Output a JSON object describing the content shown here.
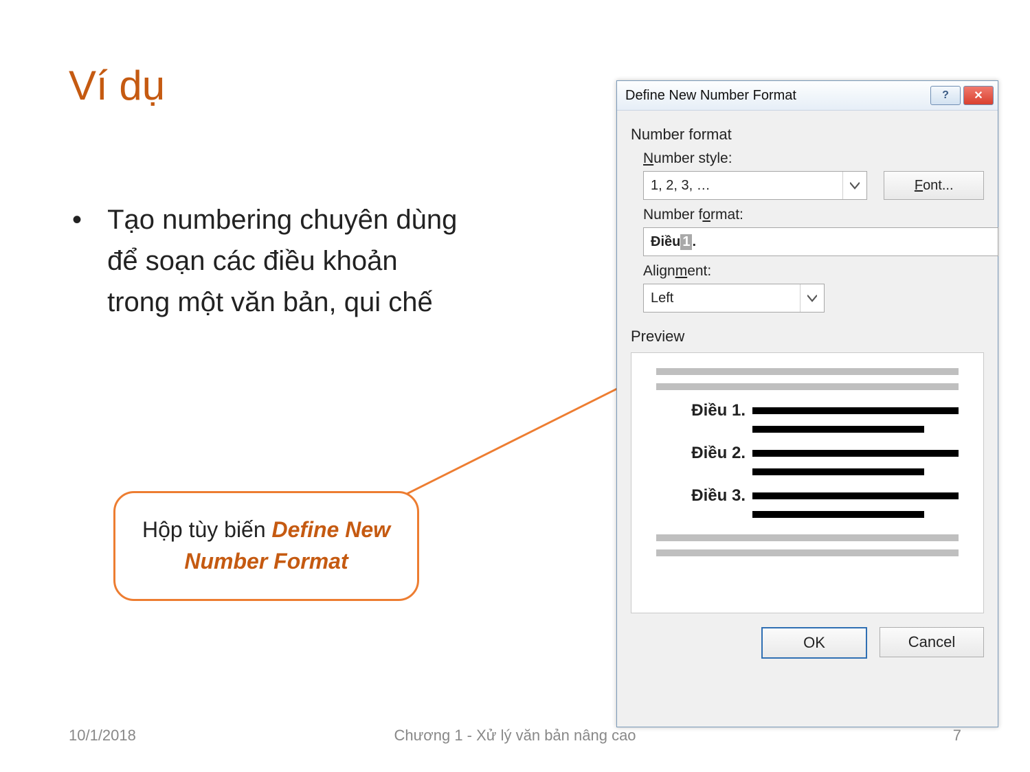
{
  "slide": {
    "title": "Ví dụ",
    "bullet": "Tạo numbering chuyên dùng để soạn các điều khoản trong một văn bản, qui chế",
    "callout_prefix": "Hộp tùy biến ",
    "callout_emph": "Define New Number Format",
    "footer_date": "10/1/2018",
    "footer_center": "Chương 1 - Xử lý văn bản nâng cao",
    "footer_page": "7"
  },
  "dialog": {
    "title": "Define New Number Format",
    "section_number_format": "Number format",
    "label_number_style_pre": "N",
    "label_number_style_post": "umber style:",
    "number_style_value": "1, 2, 3, …",
    "font_button_pre": "F",
    "font_button_post": "ont...",
    "label_number_format_pre": "Number f",
    "label_number_format_u": "o",
    "label_number_format_post": "rmat:",
    "number_format_prefix": "Điều ",
    "number_format_num": "1",
    "number_format_suffix": ".",
    "label_alignment_pre": "Align",
    "label_alignment_u": "m",
    "label_alignment_post": "ent:",
    "alignment_value": "Left",
    "section_preview": "Preview",
    "preview_items": [
      "Điều 1.",
      "Điều 2.",
      "Điều 3."
    ],
    "ok": "OK",
    "cancel": "Cancel"
  }
}
